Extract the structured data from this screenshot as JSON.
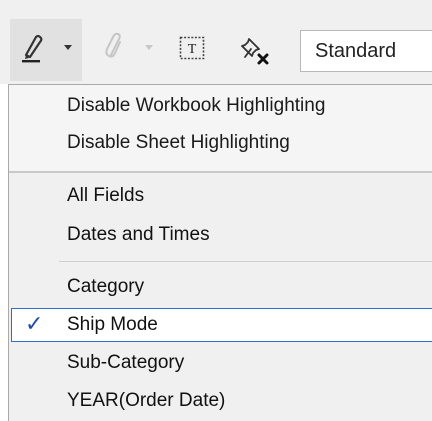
{
  "toolbar": {
    "highlighter_icon": "highlighter-pen-icon",
    "dropdown_icon": "chevron-down-icon",
    "attach_icon": "paperclip-icon",
    "text_icon": "text-box-icon",
    "text_glyph": "T",
    "clear_pin_icon": "pin-clear-icon",
    "mark_type": "Standard"
  },
  "menu": {
    "highlight_options": [
      "Disable Workbook Highlighting",
      "Disable Sheet Highlighting"
    ],
    "field_groups": [
      "All Fields",
      "Dates and Times"
    ],
    "fields": [
      {
        "label": "Category",
        "checked": false
      },
      {
        "label": "Ship Mode",
        "checked": true
      },
      {
        "label": "Sub-Category",
        "checked": false
      },
      {
        "label": "YEAR(Order Date)",
        "checked": false
      }
    ],
    "check_glyph": "✓"
  },
  "colors": {
    "toolbar_bg": "#f0f0f0",
    "pressed_bg": "#e1e1e1",
    "menu_bg": "#f0f0f0",
    "check_accent": "#2f6fc1"
  }
}
